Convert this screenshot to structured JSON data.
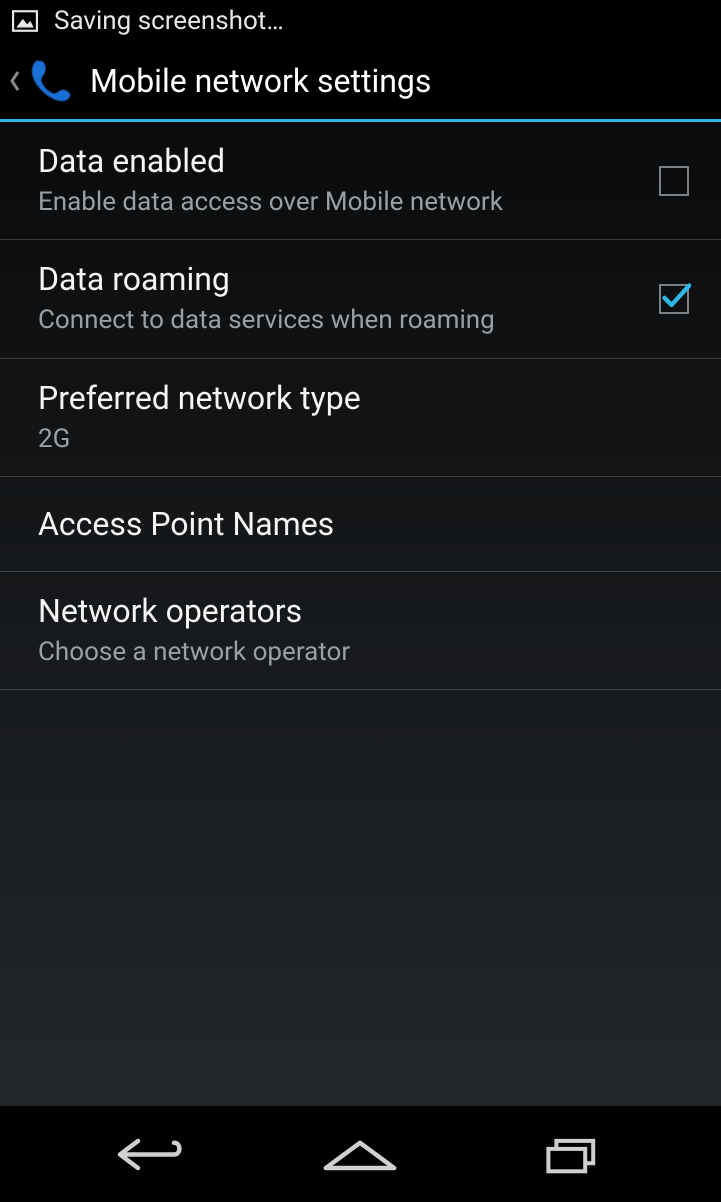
{
  "statusbar": {
    "notification_text": "Saving screenshot…"
  },
  "actionbar": {
    "title": "Mobile network settings"
  },
  "settings": [
    {
      "title": "Data enabled",
      "subtitle": "Enable data access over Mobile network",
      "checkbox": true,
      "checked": false
    },
    {
      "title": "Data roaming",
      "subtitle": "Connect to data services when roaming",
      "checkbox": true,
      "checked": true
    },
    {
      "title": "Preferred network type",
      "subtitle": "2G",
      "checkbox": false
    },
    {
      "title": "Access Point Names",
      "subtitle": "",
      "checkbox": false
    },
    {
      "title": "Network operators",
      "subtitle": "Choose a network operator",
      "checkbox": false
    }
  ],
  "colors": {
    "accent": "#2eb6e6"
  }
}
